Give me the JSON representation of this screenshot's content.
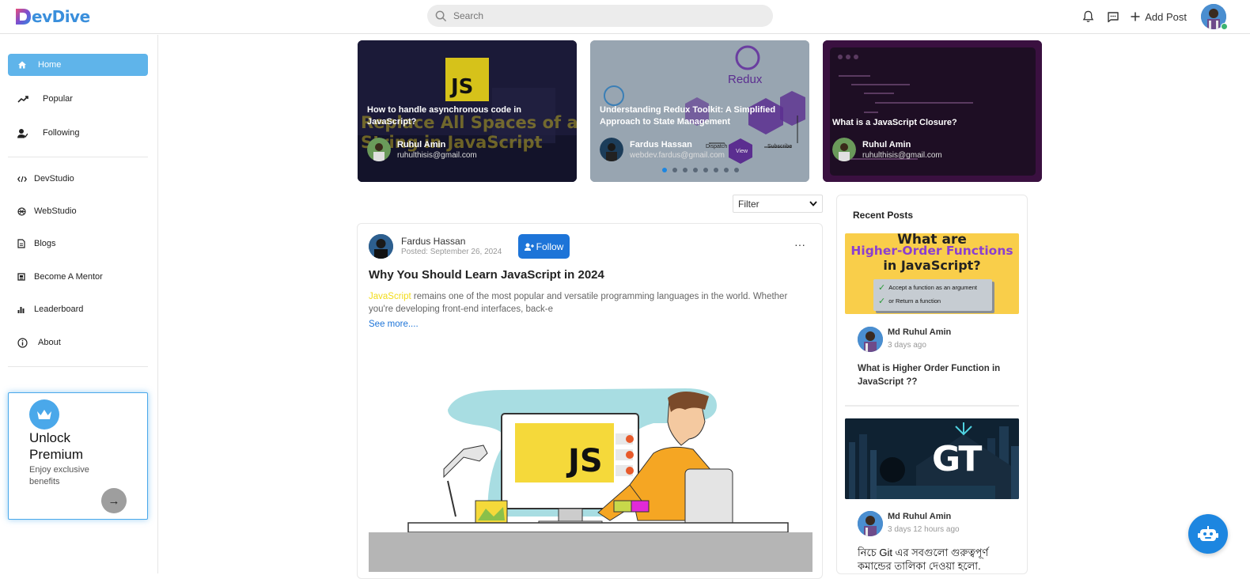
{
  "app": {
    "logo_text": "evDive",
    "logo_letter": "D"
  },
  "topbar": {
    "search_placeholder": "Search",
    "add_post_label": "Add Post"
  },
  "sidebar": {
    "items": [
      {
        "label": "Home",
        "icon": "home-icon"
      },
      {
        "label": "Popular",
        "icon": "trending-icon"
      },
      {
        "label": "Following",
        "icon": "user-check-icon"
      },
      {
        "label": "DevStudio",
        "icon": "code-icon"
      },
      {
        "label": "WebStudio",
        "icon": "web-icon"
      },
      {
        "label": "Blogs",
        "icon": "document-icon"
      },
      {
        "label": "Become A Mentor",
        "icon": "mentor-icon"
      },
      {
        "label": "Leaderboard",
        "icon": "bar-chart-icon"
      },
      {
        "label": "About",
        "icon": "info-icon"
      }
    ],
    "premium": {
      "title": "Unlock Premium",
      "subtitle": "Enjoy exclusive benefits",
      "arrow": "→"
    }
  },
  "featured": [
    {
      "title": "How to handle asynchronous code in JavaScript?",
      "author": "Ruhul Amin",
      "email": "ruhulthisis@gmail.com",
      "bg_text": "Replace All Spaces of a String in JavaScript",
      "badge": "JS"
    },
    {
      "title": "Understanding Redux Toolkit: A Simplified Approach to State Management",
      "author": "Fardus Hassan",
      "email": "webdev.fardus@gmail.com",
      "bg_text": "Redux",
      "dispatch": "Dispatch",
      "subscribe": "Subscribe",
      "view": "View"
    },
    {
      "title": "What is a JavaScript Closure?",
      "author": "Ruhul Amin",
      "email": "ruhulthisis@gmail.com"
    }
  ],
  "carousel": {
    "dots": 8,
    "active_dot": 0
  },
  "filter": {
    "label": "Filter",
    "options": [
      "Filter"
    ]
  },
  "post": {
    "author": "Fardus Hassan",
    "date": "Posted: September 26, 2024",
    "follow_label": "Follow",
    "more": "···",
    "title": "Why You Should Learn JavaScript in 2024",
    "highlight": "JavaScript",
    "body_rest": " remains one of the most popular and versatile programming languages in the world. Whether you're developing front-end interfaces, back-e",
    "see_more": "See more....",
    "illustration_text": "JS"
  },
  "recent": {
    "heading": "Recent Posts",
    "items": [
      {
        "image_title_1": "What are",
        "image_title_2": "Higher-Order Functions",
        "image_title_3": "in JavaScript?",
        "check_1": "Accept a function as an argument",
        "check_2": "or Return a function",
        "author": "Md Ruhul Amin",
        "time": "3 days ago",
        "title": "What is Higher Order Function in JavaScript ??"
      },
      {
        "image_text": "GT",
        "author": "Md Ruhul Amin",
        "time": "3 days 12 hours ago",
        "title": "নিচে Git এর সবগুলো গুরুত্বপূর্ণ কমান্ডের তালিকা দেওয়া হলো."
      }
    ]
  },
  "colors": {
    "accent": "#1d74d8",
    "sidebar_active": "#5fb4ea",
    "premium_border": "#4aa8ea",
    "highlight": "#f2dc1a"
  }
}
